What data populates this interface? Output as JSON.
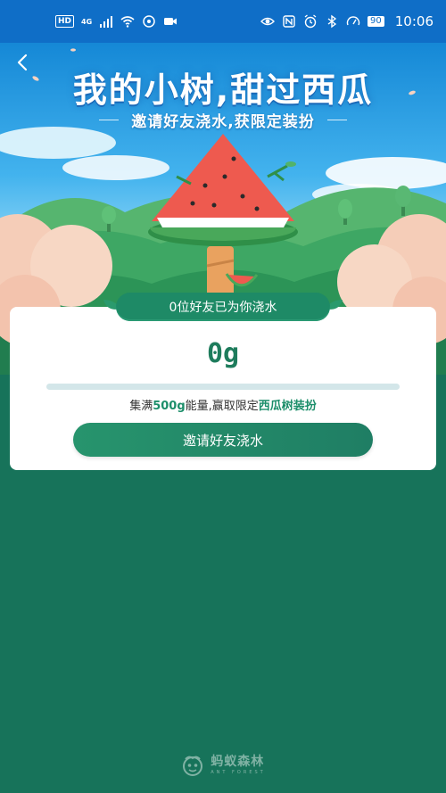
{
  "status_bar": {
    "left_badge": "HD",
    "network": "4G",
    "battery": "90",
    "time": "10:06"
  },
  "hero": {
    "title": "我的小树,甜过西瓜",
    "subtitle": "邀请好友浇水,获限定装扮"
  },
  "card": {
    "watered_text": "0位好友已为你浇水",
    "energy_value": "0g",
    "progress": 0,
    "goal_prefix": "集满",
    "goal_amount": "500g",
    "goal_middle": "能量,赢取限定",
    "goal_reward": "西瓜树装扮",
    "invite_button": "邀请好友浇水"
  },
  "footer": {
    "brand": "蚂蚁森林",
    "brand_en": "ANT FOREST"
  },
  "colors": {
    "background": "#17735a",
    "accent": "#1f8a66",
    "status_bar": "#0f6ec7"
  }
}
